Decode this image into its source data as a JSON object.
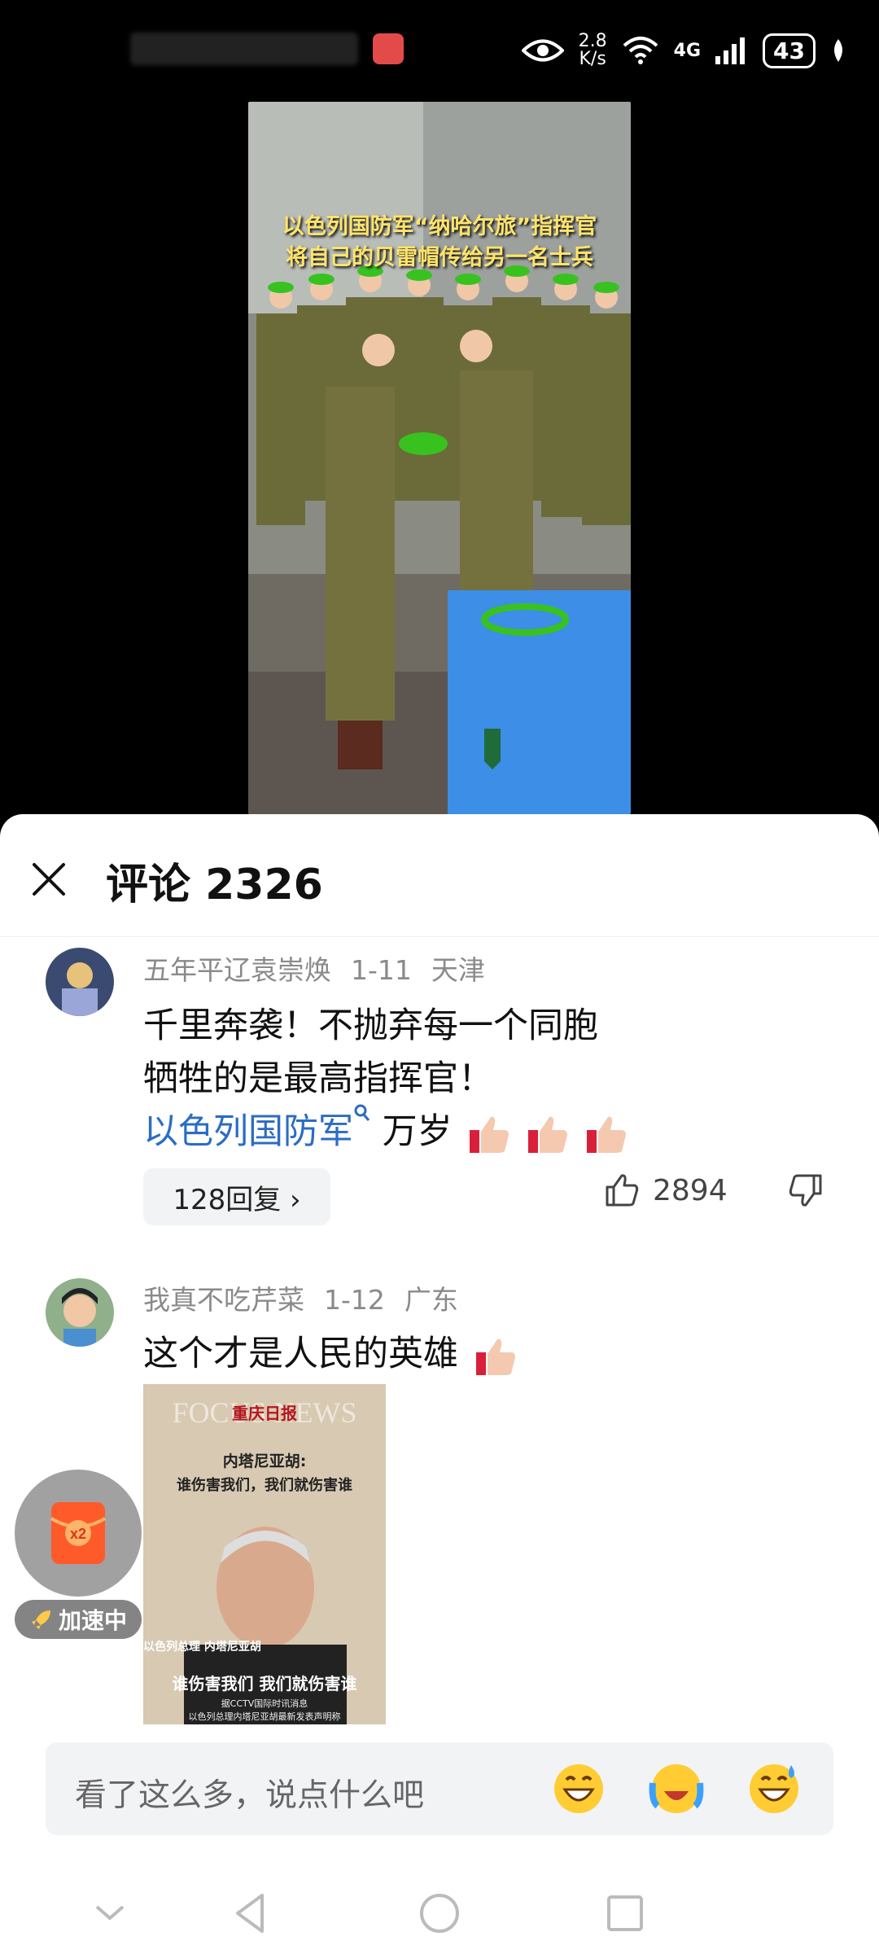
{
  "status_bar": {
    "net_speed_value": "2.8",
    "net_speed_unit": "K/s",
    "network": "4G",
    "battery": "43"
  },
  "video": {
    "caption_line1": "以色列国防军“纳哈尔旅”指挥官",
    "caption_line2": "将自己的贝雷帽传给另一名士兵"
  },
  "comments_panel": {
    "title": "评论 2326"
  },
  "comments": [
    {
      "user": "五年平辽袁崇焕",
      "date": "1-11",
      "location": "天津",
      "line1": "千里奔袭！不抛弃每一个同胞",
      "line2": "牺牲的是最高指挥官！",
      "link_text": "以色列国防军",
      "line3_suffix": " 万岁",
      "replies": "128回复 ›",
      "likes": "2894"
    },
    {
      "user": "我真不吃芹菜",
      "date": "1-12",
      "location": "广东",
      "line1": "这个才是人民的英雄",
      "image": {
        "watermark": "FOCUS NEWS",
        "brand": "重庆日报",
        "headline_name": "内塔尼亚胡:",
        "headline": "谁伤害我们，我们就伤害谁",
        "caption_small": "以色列总理 内塔尼亚胡",
        "caption_big": "谁伤害我们 我们就伤害谁",
        "caption_note1": "据CCTV国际时讯消息",
        "caption_note2": "以色列总理内塔尼亚胡最新发表声明称"
      }
    }
  ],
  "float_widget": {
    "multiplier": "x2",
    "label": "加速中"
  },
  "input": {
    "placeholder": "看了这么多，说点什么吧"
  },
  "colors": {
    "link": "#2b6cc4",
    "caption": "#ffe46b",
    "beret": "#38c21f"
  }
}
